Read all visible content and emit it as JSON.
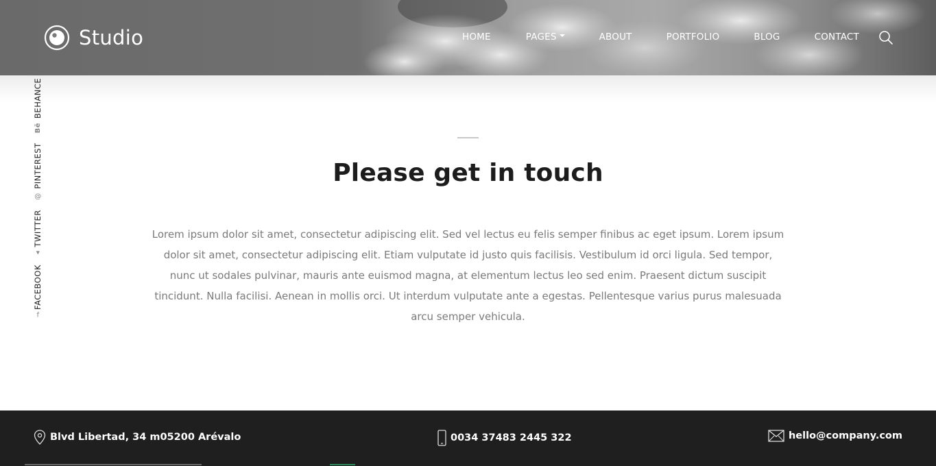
{
  "brand": {
    "name": "Studio"
  },
  "nav": {
    "items": [
      {
        "label": "HOME",
        "has_dropdown": false
      },
      {
        "label": "PAGES",
        "has_dropdown": true
      },
      {
        "label": "ABOUT",
        "has_dropdown": false
      },
      {
        "label": "PORTFOLIO",
        "has_dropdown": false
      },
      {
        "label": "BLOG",
        "has_dropdown": false
      },
      {
        "label": "CONTACT",
        "has_dropdown": false
      }
    ],
    "search_icon": "search-icon"
  },
  "social": [
    {
      "label": "FACEBOOK",
      "icon": "facebook-icon",
      "glyph": "f"
    },
    {
      "label": "TWITTER",
      "icon": "twitter-icon",
      "glyph": "🐦"
    },
    {
      "label": "PINTEREST",
      "icon": "pinterest-icon",
      "glyph": "℗"
    },
    {
      "label": "BEHANCE",
      "icon": "behance-icon",
      "glyph": "Bē"
    }
  ],
  "main": {
    "title": "Please get in touch",
    "lead": "Lorem ipsum dolor sit amet, consectetur adipiscing elit. Sed vel lectus eu felis semper finibus ac eget ipsum. Lorem ipsum dolor sit amet, consectetur adipiscing elit. Etiam vulputate id justo quis facilisis. Vestibulum id orci ligula. Sed tempor, nunc ut sodales pulvinar, mauris ante euismod magna, at elementum lectus leo sed enim. Praesent dictum suscipit tincidunt. Nulla facilisi. Aenean in mollis orci. Ut interdum vulputate ante a egestas. Pellentesque varius purus malesuada arcu semper vehicula."
  },
  "footer": {
    "address": "Blvd Libertad, 34 m05200 Arévalo",
    "phone": "0034 37483 2445 322",
    "email": "hello@company.com"
  },
  "colors": {
    "footer_bg": "#1f1f1f",
    "title": "#1c1c1c",
    "body_text": "#7a7a7a"
  }
}
